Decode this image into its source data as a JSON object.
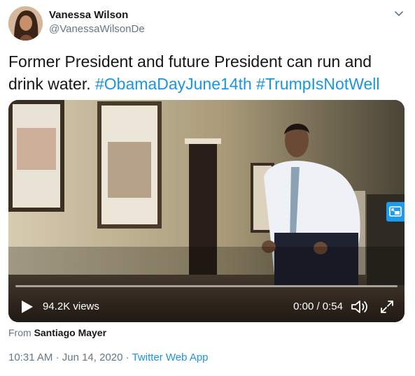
{
  "author": {
    "display_name": "Vanessa Wilson",
    "handle": "@VanessaWilsonDe"
  },
  "tweet": {
    "text": "Former President and future President can run and drink water.",
    "hashtags": [
      "#ObamaDayJune14th",
      "#TrumpIsNotWell"
    ]
  },
  "video": {
    "views": "94.2K views",
    "time": "0:00 / 0:54",
    "progress": 0,
    "icons": [
      "play-icon",
      "volume-icon",
      "fullscreen-icon",
      "picture-in-picture-icon"
    ]
  },
  "attribution": {
    "prefix": "From",
    "name": "Santiago Mayer"
  },
  "meta": {
    "time": "10:31 AM",
    "sep1": "·",
    "date": "Jun 14, 2020",
    "sep2": "·",
    "app": "Twitter Web App"
  },
  "colors": {
    "link": "#1b95e0",
    "secondary_text": "#657786",
    "primary_text": "#14171a"
  }
}
